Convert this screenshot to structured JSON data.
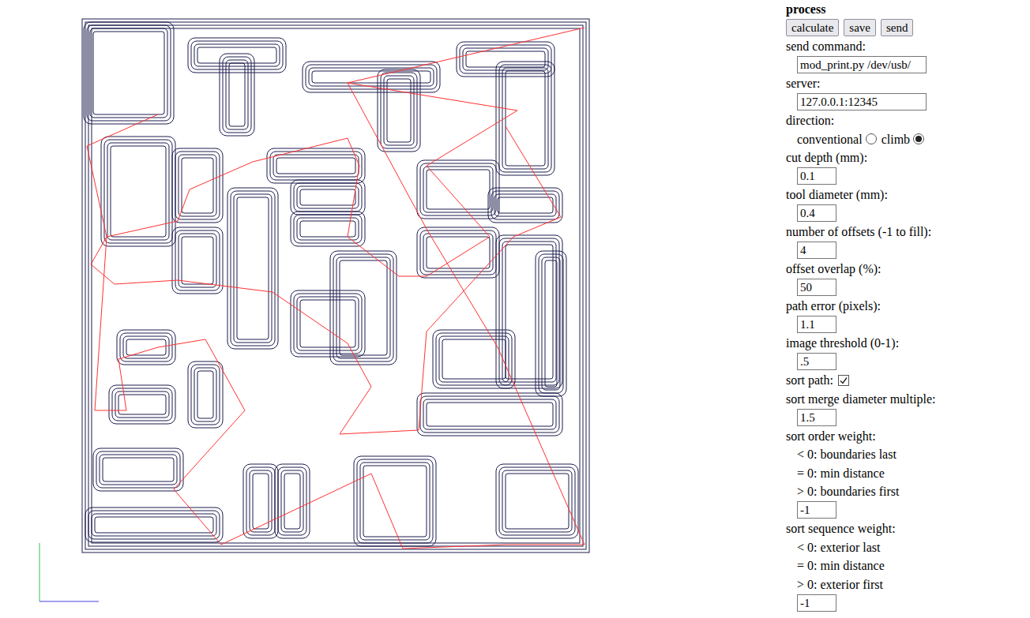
{
  "panel": {
    "title": "process",
    "buttons": [
      "calculate",
      "save",
      "send"
    ],
    "fields": [
      {
        "kind": "text",
        "label": "send command:",
        "value": "mod_print.py /dev/usb/"
      },
      {
        "kind": "text",
        "label": "server:",
        "value": "127.0.0.1:12345"
      },
      {
        "kind": "radio",
        "label": "direction:",
        "options": [
          {
            "label": "conventional",
            "selected": false
          },
          {
            "label": "climb",
            "selected": true
          }
        ]
      },
      {
        "kind": "number",
        "label": "cut depth (mm):",
        "value": "0.1"
      },
      {
        "kind": "number",
        "label": "tool diameter (mm):",
        "value": "0.4"
      },
      {
        "kind": "number",
        "label": "number of offsets (-1 to fill):",
        "value": "4"
      },
      {
        "kind": "number",
        "label": "offset overlap (%):",
        "value": "50"
      },
      {
        "kind": "number",
        "label": "path error (pixels):",
        "value": "1.1"
      },
      {
        "kind": "number",
        "label": "image threshold (0-1):",
        "value": ".5"
      },
      {
        "kind": "checkbox",
        "label": "sort path:",
        "checked": true
      },
      {
        "kind": "number",
        "label": "sort merge diameter multiple:",
        "value": "1.5"
      },
      {
        "kind": "number",
        "label": "sort order weight:",
        "notes": [
          "< 0: boundaries last",
          "= 0: min distance",
          "> 0: boundaries first"
        ],
        "value": "-1"
      },
      {
        "kind": "number",
        "label": "sort sequence weight:",
        "notes": [
          "< 0: exterior last",
          "= 0: min distance",
          "> 0: exterior first"
        ],
        "value": "-1"
      }
    ]
  }
}
